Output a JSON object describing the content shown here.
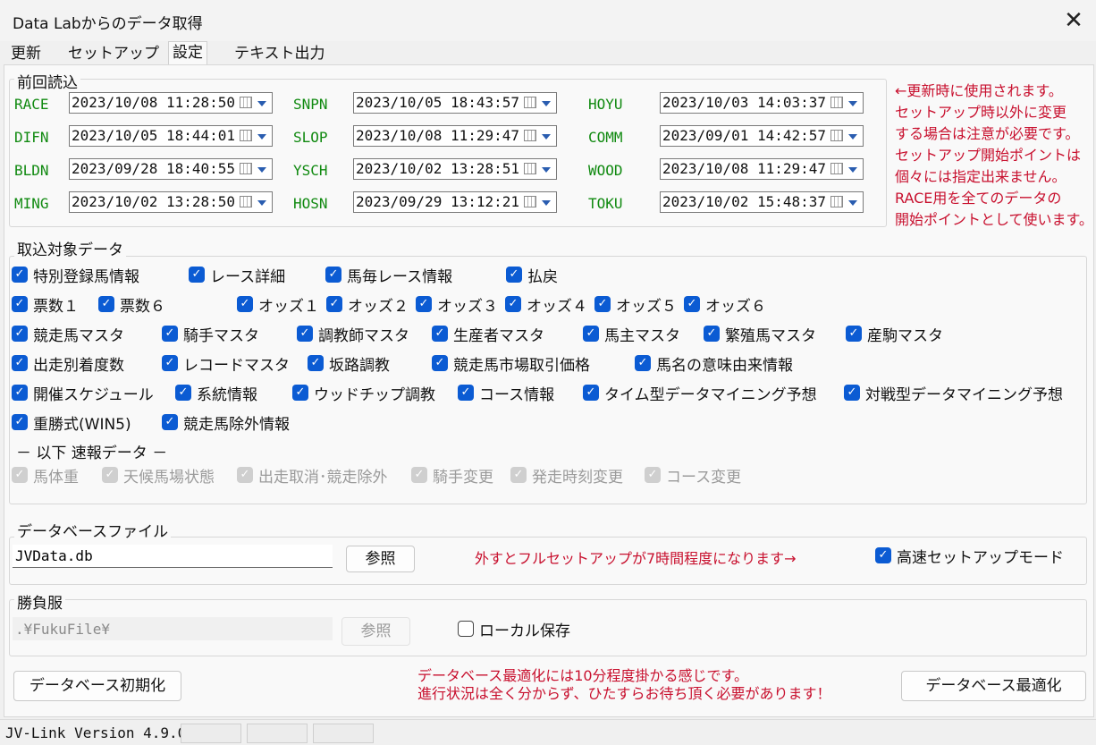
{
  "window": {
    "title": "Data Labからのデータ取得",
    "close": "✕"
  },
  "tabs": [
    "更新",
    "セットアップ",
    "設定",
    "テキスト出力"
  ],
  "last_read": {
    "legend": "前回読込",
    "rows": [
      {
        "code": "RACE",
        "value": "2023/10/08 11:28:50"
      },
      {
        "code": "SNPN",
        "value": "2023/10/05 18:43:57"
      },
      {
        "code": "HOYU",
        "value": "2023/10/03 14:03:37"
      },
      {
        "code": "DIFN",
        "value": "2023/10/05 18:44:01"
      },
      {
        "code": "SLOP",
        "value": "2023/10/08 11:29:47"
      },
      {
        "code": "COMM",
        "value": "2023/09/01 14:42:57"
      },
      {
        "code": "BLDN",
        "value": "2023/09/28 18:40:55"
      },
      {
        "code": "YSCH",
        "value": "2023/10/02 13:28:51"
      },
      {
        "code": "WOOD",
        "value": "2023/10/08 11:29:47"
      },
      {
        "code": "MING",
        "value": "2023/10/02 13:28:50"
      },
      {
        "code": "HOSN",
        "value": "2023/09/29 13:12:21"
      },
      {
        "code": "TOKU",
        "value": "2023/10/02 15:48:37"
      }
    ],
    "note": [
      "←更新時に使用されます。",
      "セットアップ時以外に変更",
      "する場合は注意が必要です。",
      "セットアップ開始ポイントは",
      "個々には指定出来ません。",
      "RACE用を全てのデータの",
      "開始ポイントとして使います。"
    ]
  },
  "targets": {
    "legend": "取込対象データ",
    "items": [
      "特別登録馬情報",
      "レース詳細",
      "馬毎レース情報",
      "払戻",
      "票数１",
      "票数６",
      "オッズ１",
      "オッズ２",
      "オッズ３",
      "オッズ４",
      "オッズ５",
      "オッズ６",
      "競走馬マスタ",
      "騎手マスタ",
      "調教師マスタ",
      "生産者マスタ",
      "馬主マスタ",
      "繁殖馬マスタ",
      "産駒マスタ",
      "出走別着度数",
      "レコードマスタ",
      "坂路調教",
      "競走馬市場取引価格",
      "馬名の意味由来情報",
      "開催スケジュール",
      "系統情報",
      "ウッドチップ調教",
      "コース情報",
      "タイム型データマイニング予想",
      "対戦型データマイニング予想",
      "重勝式(WIN5)",
      "競走馬除外情報"
    ],
    "flash_header": "－ 以下 速報データ －",
    "flash_items": [
      "馬体重",
      "天候馬場状態",
      "出走取消･競走除外",
      "騎手変更",
      "発走時刻変更",
      "コース変更"
    ]
  },
  "database": {
    "legend": "データベースファイル",
    "file": "JVData.db",
    "browse": "参照",
    "note": "外すとフルセットアップが7時間程度になります→",
    "fast_mode": "高速セットアップモード"
  },
  "silks": {
    "legend": "勝負服",
    "path": ".¥FukuFile¥",
    "browse": "参照",
    "local_save": "ローカル保存"
  },
  "footer": {
    "init_button": "データベース初期化",
    "note1": "データベース最適化には10分程度掛かる感じです。",
    "note2": "進行状況は全く分からず、ひたすらお待ち頂く必要があります！",
    "optimize_button": "データベース最適化"
  },
  "status": {
    "version": "JV-Link Version 4.9.0"
  },
  "colors": {
    "accent": "#0b5bd3",
    "code_green": "#118a11",
    "note_red": "#c8102e"
  },
  "icons": {
    "close": "close-icon",
    "calendar": "calendar-icon",
    "dropdown": "chevron-down-icon",
    "checkbox": "checkmark-icon"
  }
}
